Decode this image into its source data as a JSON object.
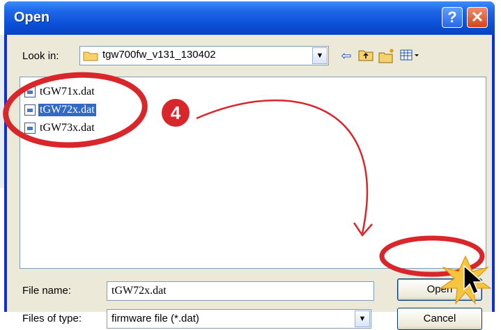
{
  "window": {
    "title": "Open",
    "help_glyph": "?",
    "close_glyph": "✕"
  },
  "lookin": {
    "label": "Look in:",
    "value": "tgw700fw_v131_130402",
    "folder_icon": "folder-icon",
    "tools": [
      "back-arrow-icon",
      "up-folder-icon",
      "new-folder-icon",
      "view-menu-icon"
    ]
  },
  "files": [
    {
      "name": "tGW71x.dat",
      "selected": false
    },
    {
      "name": "tGW72x.dat",
      "selected": true
    },
    {
      "name": "tGW73x.dat",
      "selected": false
    }
  ],
  "filename": {
    "label": "File name:",
    "value": "tGW72x.dat"
  },
  "filetype": {
    "label": "Files of type:",
    "value": "firmware file (*.dat)"
  },
  "buttons": {
    "open": "Open",
    "cancel": "Cancel"
  },
  "annotation": {
    "step": "4",
    "highlight_color": "#d9262a"
  }
}
